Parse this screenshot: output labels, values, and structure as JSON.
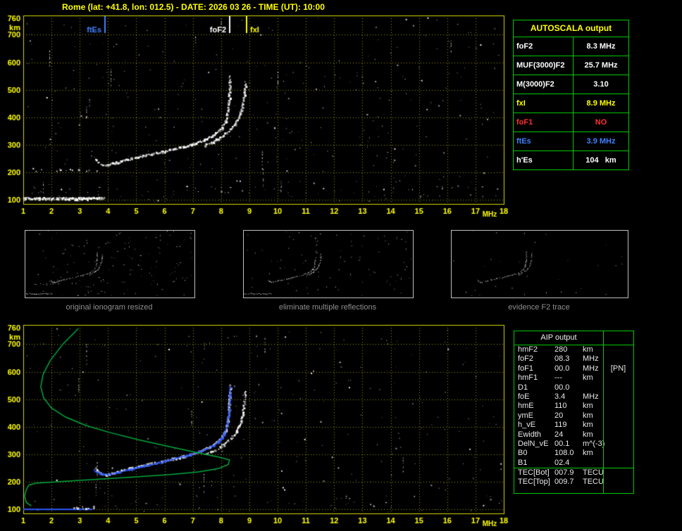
{
  "title": "Rome (lat: +41.8, lon: 012.5) - DATE: 2026 03 26 - TIME (UT): 10:00",
  "colors": {
    "accent_yellow": "#ffff00",
    "table_green": "#00c800",
    "marker_blue": "#4080ff",
    "trace_blue": "#2f5bff",
    "profile_green": "#00a83c",
    "alert_red": "#ff3030"
  },
  "autoscala": {
    "header": "AUTOSCALA output",
    "rows": [
      {
        "label": "foF2",
        "value": "8.3 MHz",
        "color": "#ffffff"
      },
      {
        "label": "MUF(3000)F2",
        "value": "25.7 MHz",
        "color": "#ffffff"
      },
      {
        "label": "M(3000)F2",
        "value": "3.10",
        "color": "#ffffff"
      },
      {
        "label": "fxI",
        "value": "8.9 MHz",
        "color": "#ffff00"
      },
      {
        "label": "foF1",
        "value": "NO",
        "color": "#ff3030"
      },
      {
        "label": "ftEs",
        "value": "3.9 MHz",
        "color": "#4080ff"
      },
      {
        "label": "h'Es",
        "value": "104   km",
        "color": "#ffffff"
      }
    ]
  },
  "aip": {
    "header": "AIP output",
    "rows": [
      {
        "label": "hmF2",
        "value": "280",
        "unit": "km",
        "note": ""
      },
      {
        "label": "foF2",
        "value": "08.3",
        "unit": "MHz",
        "note": ""
      },
      {
        "label": "foF1",
        "value": "00.0",
        "unit": "MHz",
        "note": "[PN]"
      },
      {
        "label": "hmF1",
        "value": "---",
        "unit": "km",
        "note": ""
      },
      {
        "label": "D1",
        "value": "00.0",
        "unit": "",
        "note": ""
      },
      {
        "label": "foE",
        "value": "3.4",
        "unit": "MHz",
        "note": ""
      },
      {
        "label": "hmE",
        "value": "110",
        "unit": "km",
        "note": ""
      },
      {
        "label": "ymE",
        "value": "20",
        "unit": "km",
        "note": ""
      },
      {
        "label": "h_vE",
        "value": "119",
        "unit": "km",
        "note": ""
      },
      {
        "label": "Ewidth",
        "value": "24",
        "unit": "km",
        "note": ""
      },
      {
        "label": "DelN_vE",
        "value": "00.1",
        "unit": "m^(-3)",
        "note": ""
      },
      {
        "label": "B0",
        "value": "108.0",
        "unit": "km",
        "note": ""
      },
      {
        "label": "B1",
        "value": "02.4",
        "unit": "",
        "note": ""
      }
    ],
    "tec_rows": [
      {
        "label": "TEC[Bot]",
        "value": "007.9",
        "unit": "TECU",
        "note": ""
      },
      {
        "label": "TEC[Top]",
        "value": "009.7",
        "unit": "TECU",
        "note": ""
      }
    ]
  },
  "thumbnails": [
    {
      "caption": "original ionogram resized",
      "trace_names": [
        "Es-layer",
        "Es-second-hop",
        "F2-ordinary",
        "F2-extraordinary"
      ],
      "noise": 150,
      "seed": 21
    },
    {
      "caption": "eliminate multiple reflections",
      "trace_names": [
        "Es-layer",
        "F2-ordinary",
        "F2-extraordinary"
      ],
      "noise": 90,
      "seed": 22
    },
    {
      "caption": "evidence F2 trace",
      "trace_names": [
        "F2-ordinary",
        "F2-extraordinary"
      ],
      "noise": 30,
      "seed": 23
    }
  ],
  "chart_data": [
    {
      "type": "scatter",
      "name": "scaled-ionogram",
      "title": "",
      "xlabel": "MHz",
      "ylabel": "km",
      "xlim": [
        1,
        18
      ],
      "ylim": [
        85,
        770
      ],
      "x_ticks": [
        1,
        2,
        3,
        4,
        5,
        6,
        7,
        8,
        9,
        10,
        11,
        12,
        13,
        14,
        15,
        16,
        17,
        18
      ],
      "y_ticks": [
        760,
        700,
        600,
        500,
        400,
        300,
        200,
        100
      ],
      "axis_color": "#ffff00",
      "grid_color": "rgba(205,205,0,0.75)",
      "border_color": "#d6d600",
      "markers": [
        {
          "label": "ftEs",
          "mhz": 3.9,
          "color": "#4080ff",
          "label_side": "left"
        },
        {
          "label": "foF2",
          "mhz": 8.3,
          "color": "#ffffff",
          "label_side": "left"
        },
        {
          "label": "fxI",
          "mhz": 8.9,
          "color": "#ffff00",
          "label_side": "right"
        }
      ],
      "traces": [
        {
          "name": "Es-layer",
          "color": "#ffffff",
          "style": "scatter",
          "prob": 0.95,
          "step": 0.7,
          "jitter": 1.7,
          "points": [
            [
              1.0,
              104
            ],
            [
              2.1,
              103
            ],
            [
              3.2,
              104
            ],
            [
              3.85,
              105
            ]
          ]
        },
        {
          "name": "Es-second-hop",
          "color": "#ffffff",
          "style": "scatter",
          "prob": 0.2,
          "step": 1.5,
          "jitter": 2.2,
          "points": [
            [
              1.0,
              208
            ],
            [
              3.8,
              208
            ]
          ]
        },
        {
          "name": "F2-ordinary",
          "color": "#ffffff",
          "style": "scatter",
          "prob": 0.85,
          "step": 1.1,
          "jitter": 1.4,
          "points": [
            [
              3.55,
              248
            ],
            [
              3.7,
              234
            ],
            [
              3.85,
              226
            ],
            [
              4.0,
              226
            ],
            [
              4.2,
              231
            ],
            [
              4.5,
              240
            ],
            [
              4.9,
              250
            ],
            [
              5.4,
              262
            ],
            [
              5.9,
              273
            ],
            [
              6.4,
              285
            ],
            [
              6.9,
              298
            ],
            [
              7.3,
              312
            ],
            [
              7.6,
              326
            ],
            [
              7.85,
              342
            ],
            [
              8.05,
              362
            ],
            [
              8.18,
              388
            ],
            [
              8.25,
              418
            ],
            [
              8.29,
              455
            ],
            [
              8.31,
              500
            ],
            [
              8.33,
              548
            ]
          ]
        },
        {
          "name": "F2-extraordinary",
          "color": "#ffffff",
          "style": "scatter",
          "prob": 0.8,
          "step": 1.1,
          "jitter": 1.3,
          "points": [
            [
              7.45,
              298
            ],
            [
              7.8,
              315
            ],
            [
              8.1,
              334
            ],
            [
              8.35,
              355
            ],
            [
              8.55,
              380
            ],
            [
              8.68,
              410
            ],
            [
              8.78,
              448
            ],
            [
              8.84,
              490
            ],
            [
              8.87,
              528
            ]
          ]
        }
      ],
      "noise_dots": 340,
      "noise_streaks": 12,
      "bottom_clutter": 60,
      "seed": 7
    },
    {
      "type": "scatter",
      "name": "ionogram-with-profile-fit",
      "title": "",
      "xlabel": "MHz",
      "ylabel": "km",
      "xlim": [
        1,
        18
      ],
      "ylim": [
        85,
        770
      ],
      "x_ticks": [
        1,
        2,
        3,
        4,
        5,
        6,
        7,
        8,
        9,
        10,
        11,
        12,
        13,
        14,
        15,
        16,
        17,
        18
      ],
      "y_ticks": [
        760,
        700,
        600,
        500,
        400,
        300,
        200,
        100
      ],
      "axis_color": "#ffff00",
      "grid_color": "rgba(205,205,0,0.75)",
      "border_color": "#d6d600",
      "markers": [],
      "traces": [
        {
          "name": "Es-fitted",
          "color": "#2f5bff",
          "style": "line",
          "width": 2,
          "points": [
            [
              1.0,
              100
            ],
            [
              3.45,
              100
            ]
          ]
        },
        {
          "name": "Es-remnant",
          "color": "#ffffff",
          "style": "scatter",
          "prob": 0.55,
          "step": 1.2,
          "jitter": 1.5,
          "points": [
            [
              2.75,
              104
            ],
            [
              3.5,
              107
            ]
          ]
        },
        {
          "name": "F2-ordinary",
          "color": "#ffffff",
          "style": "scatter",
          "prob": 0.8,
          "step": 1.1,
          "jitter": 1.4,
          "points": [
            [
              3.55,
              248
            ],
            [
              3.7,
              234
            ],
            [
              3.85,
              226
            ],
            [
              4.0,
              226
            ],
            [
              4.2,
              231
            ],
            [
              4.5,
              240
            ],
            [
              4.9,
              250
            ],
            [
              5.4,
              262
            ],
            [
              5.9,
              273
            ],
            [
              6.4,
              285
            ],
            [
              6.9,
              298
            ],
            [
              7.3,
              312
            ],
            [
              7.6,
              326
            ],
            [
              7.85,
              342
            ],
            [
              8.05,
              362
            ],
            [
              8.18,
              388
            ],
            [
              8.25,
              418
            ],
            [
              8.29,
              455
            ],
            [
              8.31,
              500
            ],
            [
              8.33,
              548
            ]
          ]
        },
        {
          "name": "F2-extraordinary",
          "color": "#ffffff",
          "style": "scatter",
          "prob": 0.75,
          "step": 1.1,
          "jitter": 1.3,
          "points": [
            [
              7.45,
              298
            ],
            [
              7.8,
              315
            ],
            [
              8.1,
              334
            ],
            [
              8.35,
              355
            ],
            [
              8.55,
              380
            ],
            [
              8.68,
              410
            ],
            [
              8.78,
              448
            ],
            [
              8.84,
              490
            ],
            [
              8.87,
              528
            ]
          ]
        },
        {
          "name": "F2-fitted",
          "color": "#2f5bff",
          "style": "scatter",
          "prob": 0.9,
          "step": 1.0,
          "jitter": 1.0,
          "points": [
            [
              3.5,
              243
            ],
            [
              3.68,
              231
            ],
            [
              3.85,
              225
            ],
            [
              4.05,
              226
            ],
            [
              4.3,
              232
            ],
            [
              4.6,
              240
            ],
            [
              5.0,
              250
            ],
            [
              5.5,
              262
            ],
            [
              6.0,
              274
            ],
            [
              6.5,
              287
            ],
            [
              7.0,
              300
            ],
            [
              7.4,
              315
            ],
            [
              7.7,
              330
            ],
            [
              7.95,
              348
            ],
            [
              8.1,
              370
            ],
            [
              8.2,
              398
            ],
            [
              8.27,
              432
            ],
            [
              8.3,
              470
            ],
            [
              8.32,
              515
            ],
            [
              8.33,
              545
            ]
          ]
        }
      ],
      "curves": [
        {
          "name": "electron-density-profile",
          "color": "#00a83c",
          "width": 1.5,
          "points": [
            [
              2.95,
              757
            ],
            [
              2.4,
              700
            ],
            [
              1.95,
              640
            ],
            [
              1.7,
              590
            ],
            [
              1.62,
              545
            ],
            [
              1.72,
              505
            ],
            [
              2.0,
              468
            ],
            [
              2.5,
              435
            ],
            [
              3.2,
              405
            ],
            [
              4.1,
              378
            ],
            [
              5.1,
              352
            ],
            [
              6.2,
              327
            ],
            [
              7.2,
              305
            ],
            [
              7.9,
              290
            ],
            [
              8.3,
              279
            ],
            [
              8.25,
              262
            ],
            [
              7.9,
              248
            ],
            [
              7.2,
              236
            ],
            [
              6.2,
              226
            ],
            [
              5.0,
              218
            ],
            [
              3.8,
              210
            ],
            [
              2.7,
              203
            ],
            [
              1.9,
              198
            ],
            [
              1.45,
              195
            ],
            [
              1.2,
              188
            ],
            [
              1.1,
              170
            ],
            [
              1.05,
              148
            ],
            [
              1.1,
              126
            ],
            [
              1.28,
              112
            ]
          ]
        }
      ],
      "noise_dots": 240,
      "noise_streaks": 9,
      "bottom_clutter": 40,
      "seed": 13
    }
  ]
}
